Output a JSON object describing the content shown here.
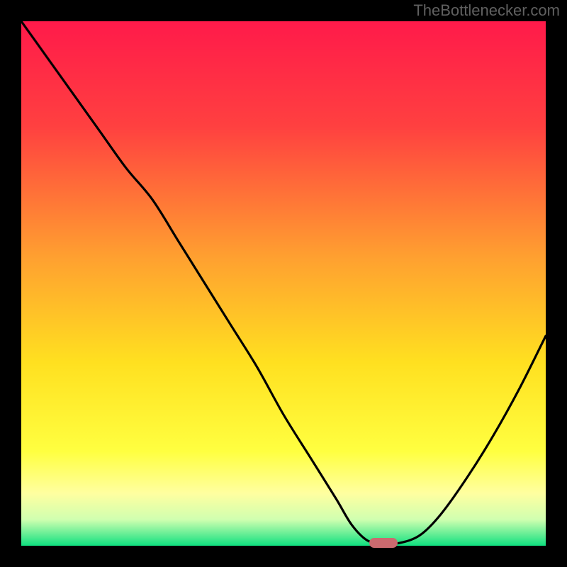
{
  "watermark": "TheBottlenecker.com",
  "chart_data": {
    "type": "line",
    "title": "",
    "xlabel": "",
    "ylabel": "",
    "xlim": [
      0,
      100
    ],
    "ylim": [
      0,
      100
    ],
    "grid": false,
    "legend": false,
    "series": [
      {
        "name": "bottleneck-curve",
        "x": [
          0,
          5,
          10,
          15,
          20,
          25,
          30,
          35,
          40,
          45,
          50,
          55,
          60,
          63,
          66,
          69,
          72,
          76,
          80,
          85,
          90,
          95,
          100
        ],
        "y": [
          100,
          93,
          86,
          79,
          72,
          66,
          58,
          50,
          42,
          34,
          25,
          17,
          9,
          4,
          1,
          0.5,
          0.5,
          2,
          6,
          13,
          21,
          30,
          40
        ]
      }
    ],
    "marker": {
      "x": 69,
      "y": 0.5,
      "color": "#cb6a6f"
    },
    "background_gradient": {
      "stops": [
        {
          "pct": 0,
          "color": "#ff1a4a"
        },
        {
          "pct": 20,
          "color": "#ff4040"
        },
        {
          "pct": 45,
          "color": "#ffa030"
        },
        {
          "pct": 65,
          "color": "#ffe020"
        },
        {
          "pct": 82,
          "color": "#ffff40"
        },
        {
          "pct": 90,
          "color": "#ffffa0"
        },
        {
          "pct": 95,
          "color": "#d0ffb0"
        },
        {
          "pct": 100,
          "color": "#10e080"
        }
      ]
    }
  }
}
